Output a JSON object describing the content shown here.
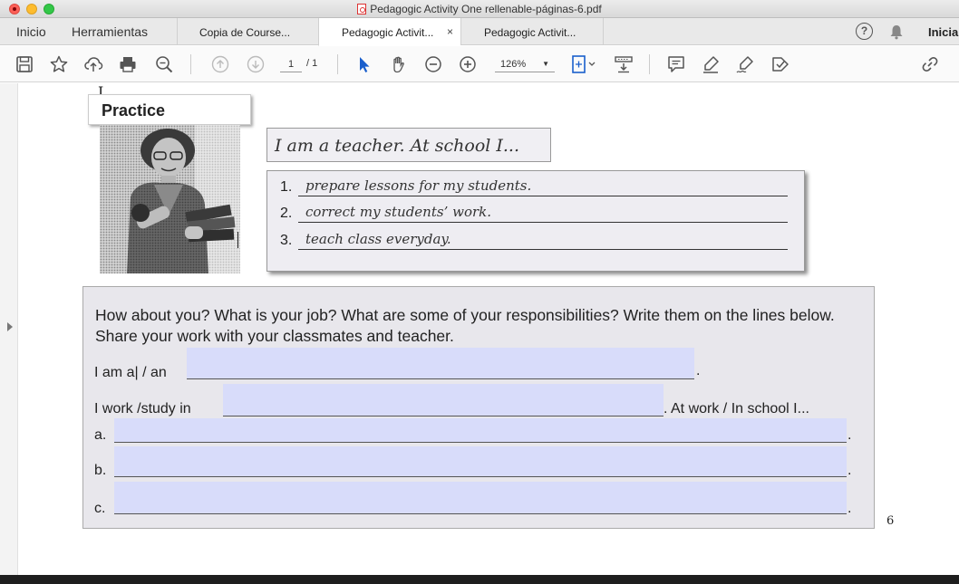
{
  "window": {
    "title": "Pedagogic Activity One rellenable-páginas-6.pdf"
  },
  "nav": {
    "home": "Inicio",
    "tools": "Herramientas",
    "tabs": [
      {
        "label": "Copia de Course..."
      },
      {
        "label": "Pedagogic Activit...",
        "close": "×"
      },
      {
        "label": "Pedagogic Activit..."
      }
    ],
    "help": "?",
    "signin": "Iniciar"
  },
  "toolbar": {
    "page_current": "1",
    "page_total": "/ 1",
    "zoom": "126%",
    "icons": [
      "save-icon",
      "star-icon",
      "upload-icon",
      "print-icon",
      "zoom-out-search-icon",
      "page-up-icon",
      "page-down-icon",
      "select-arrow-icon",
      "hand-icon",
      "zoom-minus-icon",
      "zoom-plus-icon",
      "fit-page-icon",
      "scroll-mode-icon",
      "comment-icon",
      "highlight-icon",
      "sign-icon",
      "stamp-icon",
      "link-icon"
    ]
  },
  "document": {
    "practice_title": "Practice",
    "speech": "I am a teacher. At school I...",
    "list": [
      {
        "num": "1.",
        "text": "prepare lessons for my students."
      },
      {
        "num": "2.",
        "text": "correct my students’ work."
      },
      {
        "num": "3.",
        "text": "teach class everyday."
      }
    ],
    "prompt": "How about you? What is your job? What are some of your responsibilities? Write them on the lines below. Share your work with your classmates and teacher.",
    "job_label": "I am a| / an",
    "work_label": "I work /study in",
    "work_suffix": ". At work / In school I...",
    "items": [
      {
        "label": "a."
      },
      {
        "label": "b."
      },
      {
        "label": "c."
      }
    ],
    "period": ".",
    "page_number": "6"
  }
}
